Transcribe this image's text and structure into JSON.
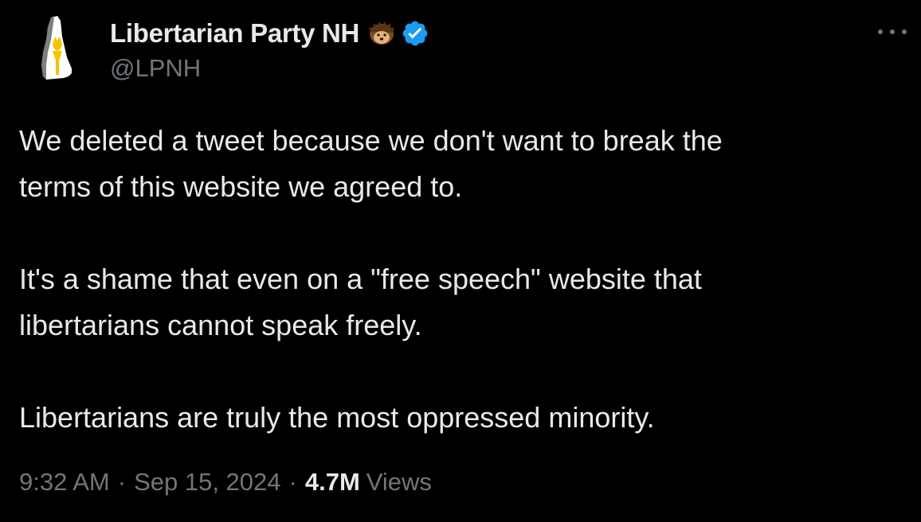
{
  "author": {
    "display_name": "Libertarian Party NH",
    "handle": "@LPNH",
    "name_emoji": "hedgehog-icon",
    "badge": "verified-icon",
    "avatar_icon": "new-hampshire-torch-logo-icon"
  },
  "tweet": {
    "paragraphs": [
      "We deleted a tweet because we don't want to break the\nterms of this website we agreed to.",
      "It's a shame that even on a \"free speech\" website that\nlibertarians cannot speak freely.",
      "Libertarians are truly the most oppressed minority."
    ]
  },
  "meta": {
    "time": "9:32 AM",
    "separator": "·",
    "date": "Sep 15, 2024",
    "views_count": "4.7M",
    "views_label": "Views"
  },
  "colors": {
    "background": "#000000",
    "text_primary": "#e7e9ea",
    "text_secondary": "#71767b",
    "verified_blue": "#1d9bf0",
    "logo_gold": "#f5c400"
  }
}
